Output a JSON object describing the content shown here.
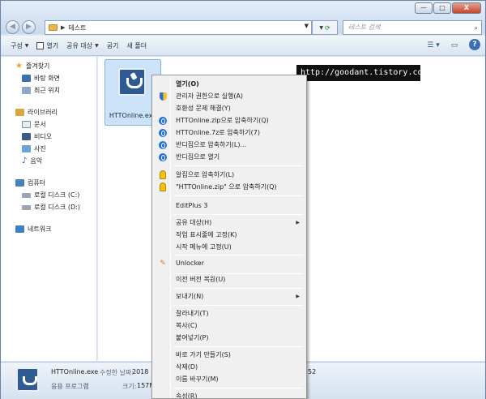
{
  "window": {
    "path": "테스트",
    "search_placeholder": "테스트 검색",
    "buttons": {
      "minimize": "—",
      "maximize": "□",
      "close": "X"
    }
  },
  "toolbar": {
    "organize": "구성",
    "open": "열기",
    "share": "공유 대상",
    "burn": "굽기",
    "new_folder": "새 폴더"
  },
  "nav": {
    "favorites": "즐겨찾기",
    "desktop": "바탕 화면",
    "recent": "최근 위치",
    "libraries": "라이브러리",
    "documents": "문서",
    "videos": "비디오",
    "pictures": "사진",
    "music": "음악",
    "computer": "컴퓨터",
    "local_c": "로컬 디스크 (C:)",
    "local_d": "로컬 디스크 (D:)",
    "network": "네트워크"
  },
  "file": {
    "name": "HTTOnline.exe"
  },
  "watermark": "http://goodant.tistory.com",
  "status": {
    "name": "HTTOnline.exe",
    "modified_label": "수정한 날짜:",
    "modified_value": "2018",
    "type": "응용 프로그램",
    "size_label": "크기:",
    "size_value": "157M",
    "time_fragment": "52"
  },
  "menu": {
    "open": "열기(O)",
    "run_admin": "관리자 권한으로 실행(A)",
    "troubleshoot": "호환성 문제 해결(Y)",
    "bandi_zip": "HTTOnline.zip으로 압축하기(Q)",
    "bandi_7z": "HTTOnline.7z로 압축하기(7)",
    "bandi_compress": "반디집으로 압축하기(L)...",
    "bandi_open": "반디집으로 열기",
    "alzip_compress": "알집으로 압축하기(L)",
    "alzip_zip": "\"HTTOnline.zip\" 으로 압축하기(Q)",
    "editplus": "EditPlus 3",
    "share": "공유 대상(H)",
    "pin_taskbar": "작업 표시줄에 고정(K)",
    "pin_start": "시작 메뉴에 고정(U)",
    "unlocker": "Unlocker",
    "restore": "이전 버전 복원(U)",
    "send_to": "보내기(N)",
    "cut": "잘라내기(T)",
    "copy": "복사(C)",
    "paste": "붙여넣기(P)",
    "shortcut": "바로 가기 만들기(S)",
    "delete": "삭제(D)",
    "rename": "이름 바꾸기(M)",
    "properties": "속성(R)"
  },
  "colors": {
    "highlight": "#e52222",
    "selection": "#cbe2f8"
  }
}
